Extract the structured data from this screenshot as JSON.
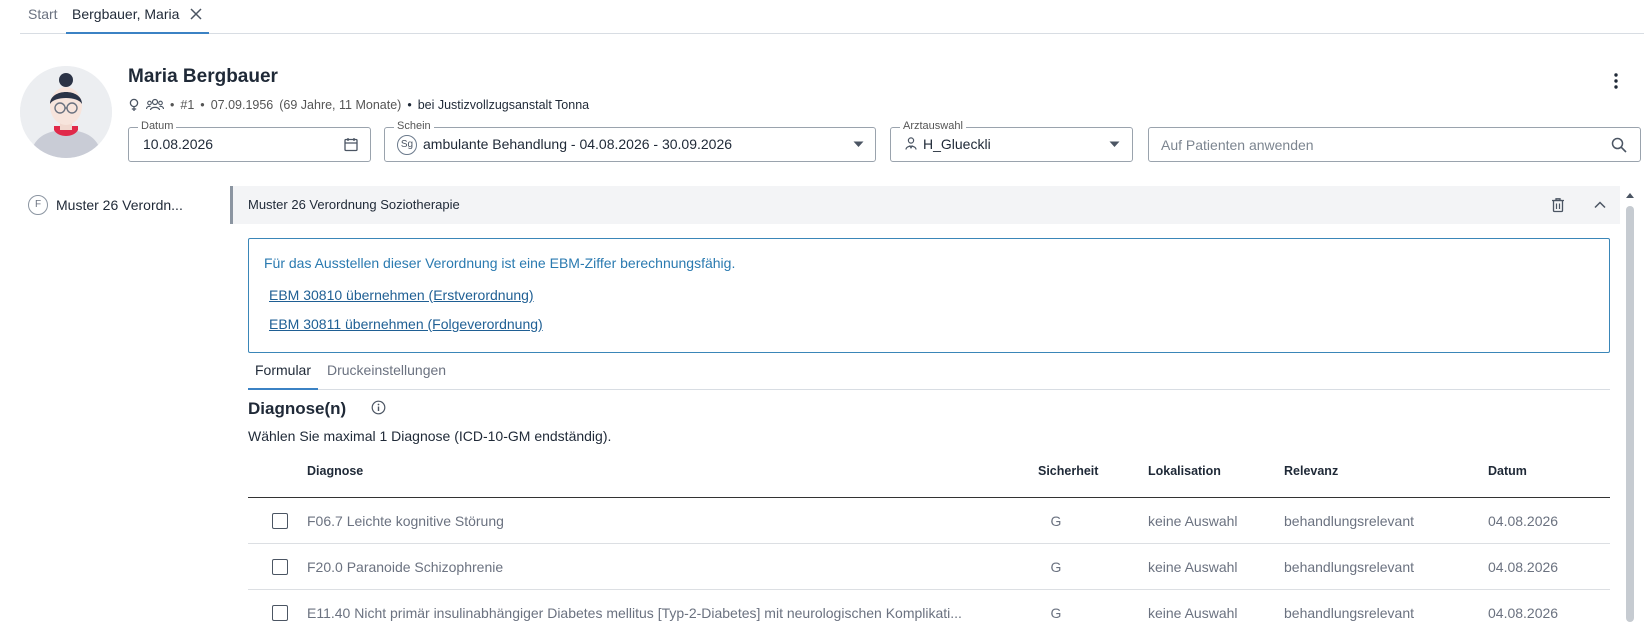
{
  "tabs": {
    "start": "Start",
    "patient": "Bergbauer, Maria"
  },
  "patient": {
    "name": "Maria Bergbauer",
    "number": "#1",
    "birth": "07.09.1956",
    "age": "(69 Jahre, 11 Monate)",
    "location": "bei Justizvollzugsanstalt Tonna"
  },
  "fields": {
    "datum_label": "Datum",
    "datum_value": "10.08.2026",
    "schein_label": "Schein",
    "schein_badge": "Sg",
    "schein_value": "ambulante Behandlung - 04.08.2026 - 30.09.2026",
    "arzt_label": "Arztauswahl",
    "arzt_value": "H_Glueckli",
    "search_placeholder": "Auf Patienten anwenden"
  },
  "sidebar": {
    "badge": "F",
    "item_label": "Muster 26 Verordn..."
  },
  "section": {
    "title": "Muster 26 Verordnung Soziotherapie"
  },
  "info": {
    "text": "Für das Ausstellen dieser Verordnung ist eine EBM-Ziffer berechnungsfähig.",
    "link1": "EBM 30810 übernehmen (Erstverordnung)",
    "link2": "EBM 30811 übernehmen (Folgeverordnung)"
  },
  "subtabs": {
    "formular": "Formular",
    "druck": "Druckeinstellungen"
  },
  "diagnosen": {
    "title": "Diagnose(n)",
    "subtitle": "Wählen Sie maximal 1 Diagnose (ICD-10-GM endständig).",
    "columns": {
      "diagnose": "Diagnose",
      "sicherheit": "Sicherheit",
      "lokalisation": "Lokalisation",
      "relevanz": "Relevanz",
      "datum": "Datum"
    },
    "rows": [
      {
        "diagnose": "F06.7 Leichte kognitive Störung",
        "sicherheit": "G",
        "lokalisation": "keine Auswahl",
        "relevanz": "behandlungsrelevant",
        "datum": "04.08.2026"
      },
      {
        "diagnose": "F20.0 Paranoide Schizophrenie",
        "sicherheit": "G",
        "lokalisation": "keine Auswahl",
        "relevanz": "behandlungsrelevant",
        "datum": "04.08.2026"
      },
      {
        "diagnose": "E11.40 Nicht primär insulinabhängiger Diabetes mellitus [Typ-2-Diabetes] mit neurologischen Komplikati...",
        "sicherheit": "G",
        "lokalisation": "keine Auswahl",
        "relevanz": "behandlungsrelevant",
        "datum": "04.08.2026"
      }
    ]
  },
  "colors": {
    "accent": "#3b82c4",
    "link": "#1f5f94",
    "info_border": "#3a86b8"
  }
}
